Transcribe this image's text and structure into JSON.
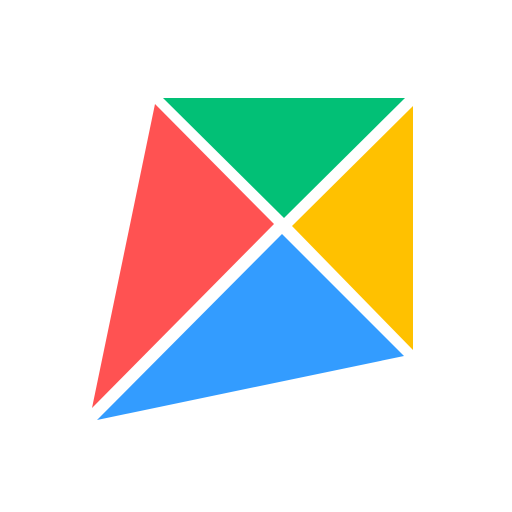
{
  "logo": {
    "icon": "four-color-kite-logo-icon",
    "background_color": "#ffffff",
    "pieces": [
      {
        "name": "top-green-triangle",
        "color": "#02C076"
      },
      {
        "name": "left-red-triangle",
        "color": "#FF5252"
      },
      {
        "name": "right-yellow-triangle",
        "color": "#FFC100"
      },
      {
        "name": "bottom-blue-triangle",
        "color": "#339CFF"
      }
    ]
  }
}
